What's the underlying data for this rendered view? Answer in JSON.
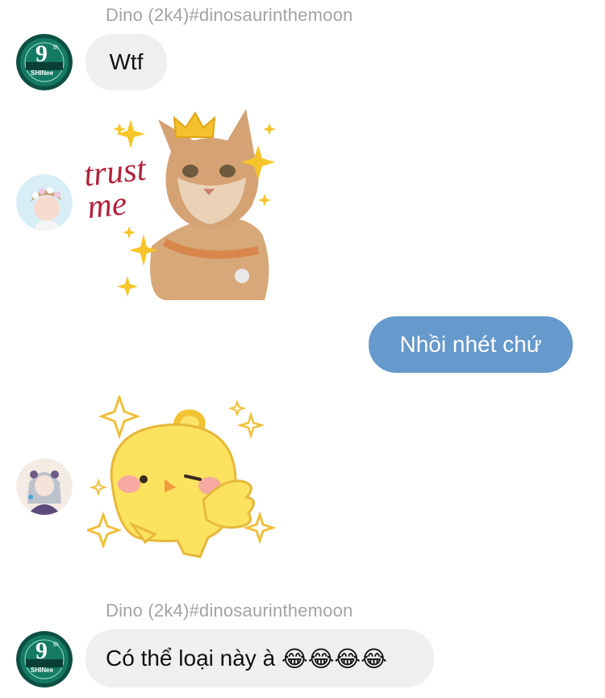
{
  "messages": [
    {
      "sender": "Dino (2k4)#dinosaurinthemoon",
      "text": "Wtf",
      "avatar": "shinee-9th-anniversary-avatar"
    },
    {
      "sticker": "trust-me-cat-sticker",
      "sticker_text": "trust me",
      "avatar": "girl-flower-crown-avatar"
    },
    {
      "text": "Nhồi nhét chứ",
      "outgoing": true
    },
    {
      "sticker": "yellow-chick-thumbs-sticker",
      "avatar": "anime-girl-avatar"
    },
    {
      "sender": "Dino (2k4)#dinosaurinthemoon",
      "text": "Có thể loại này à ",
      "emojis": "😂😂😂😂",
      "avatar": "shinee-9th-anniversary-avatar"
    }
  ],
  "avatar_badge": {
    "number": "9",
    "suffix": "th",
    "label": "SHINee"
  },
  "colors": {
    "outgoing_bubble": "#6699cc",
    "incoming_bubble": "#efefef",
    "sender_name": "#a3a3a3"
  }
}
